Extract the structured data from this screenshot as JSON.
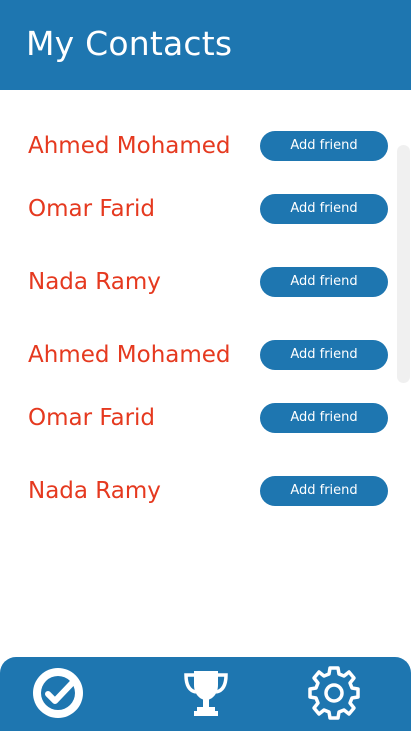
{
  "header": {
    "title": "My Contacts"
  },
  "contacts": [
    {
      "name": "Ahmed Mohamed",
      "button_label": "Add friend"
    },
    {
      "name": "Omar Farid",
      "button_label": "Add friend"
    },
    {
      "name": "Nada Ramy",
      "button_label": "Add friend"
    },
    {
      "name": "Ahmed Mohamed",
      "button_label": "Add friend"
    },
    {
      "name": "Omar Farid",
      "button_label": "Add friend"
    },
    {
      "name": "Nada Ramy",
      "button_label": "Add friend"
    }
  ],
  "bottom_nav": {
    "items": [
      {
        "icon": "check-circle-icon"
      },
      {
        "icon": "trophy-icon"
      },
      {
        "icon": "gear-icon"
      }
    ]
  },
  "colors": {
    "primary": "#1e76b0",
    "name_text": "#e5391f",
    "background": "#ffffff"
  }
}
